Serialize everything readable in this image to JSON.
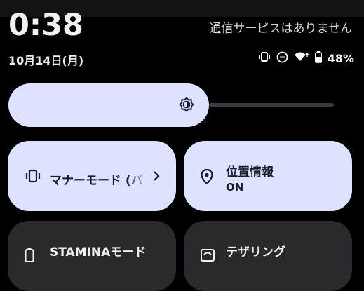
{
  "status_bar": {
    "time": "0:38",
    "carrier": "通信サービスはありません",
    "date": "10月14日(月)",
    "battery": "48%",
    "icons": [
      "vibrate-icon",
      "do-not-disturb-icon",
      "wifi-icon",
      "battery-icon"
    ]
  },
  "brightness": {
    "level_fraction": 0.6
  },
  "tiles": [
    {
      "label": "マナーモード (バ",
      "icon": "vibrate-icon",
      "state": "on"
    },
    {
      "title": "位置情報",
      "subtitle": "ON",
      "icon": "location-pin-icon",
      "state": "on"
    },
    {
      "title": "STAMINAモード",
      "icon": "battery-saver-icon",
      "state": "off"
    },
    {
      "title": "テザリング",
      "icon": "hotspot-icon",
      "state": "off"
    }
  ],
  "colors": {
    "active_tile": "#dde3ff",
    "inactive_tile": "#2a2a2d",
    "background": "#000000"
  }
}
